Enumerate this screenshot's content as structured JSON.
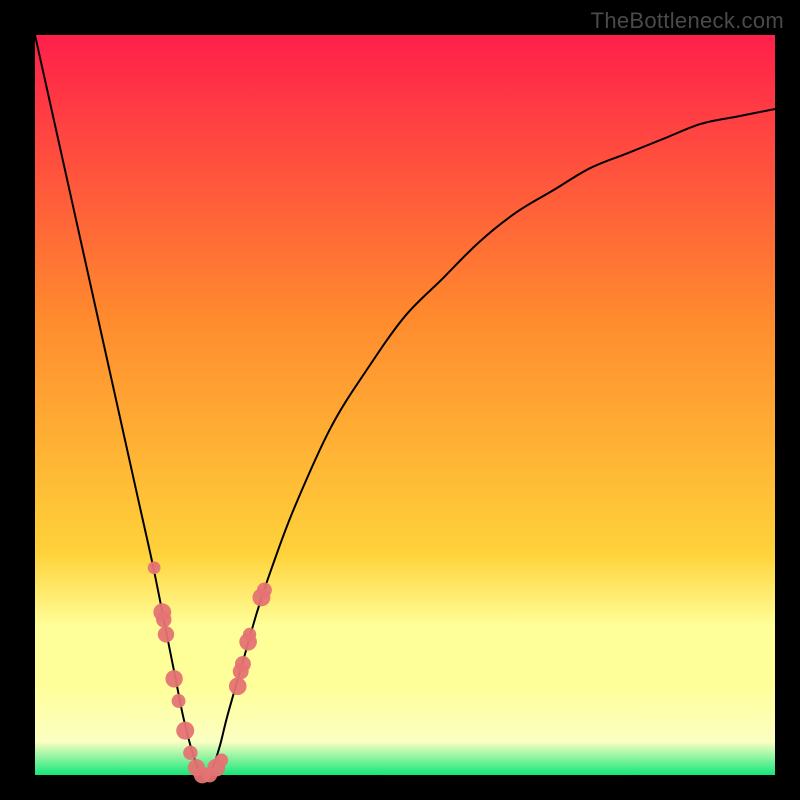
{
  "watermark": "TheBottleneck.com",
  "gradient_colors": {
    "top": "#ff1f4b",
    "mid_upper": "#ff8a2e",
    "mid": "#ffd23a",
    "band_pale": "#ffff9a",
    "band_light": "#fbffc2",
    "bottom": "#14e77a"
  },
  "curve": {
    "stroke": "#000000",
    "stroke_width": 2.0,
    "dot_color": "#e57373",
    "dot_stroke": "#c44f4f"
  },
  "chart_data": {
    "type": "line",
    "title": "",
    "xlabel": "",
    "ylabel": "",
    "xlim": [
      0,
      100
    ],
    "ylim": [
      0,
      100
    ],
    "x": [
      0,
      2,
      4,
      6,
      8,
      10,
      12,
      14,
      16,
      18,
      19,
      20,
      21,
      22,
      23,
      24,
      25,
      26,
      28,
      30,
      32,
      35,
      40,
      45,
      50,
      55,
      60,
      65,
      70,
      75,
      80,
      85,
      90,
      95,
      100
    ],
    "y": [
      100,
      91,
      82,
      73,
      64,
      55,
      46,
      37,
      28,
      18,
      13,
      8,
      4,
      1,
      0,
      1,
      4,
      8,
      15,
      22,
      28,
      36,
      47,
      55,
      62,
      67,
      72,
      76,
      79,
      82,
      84,
      86,
      88,
      89,
      90
    ],
    "dots": [
      {
        "x": 16.1,
        "y": 28
      },
      {
        "x": 17.2,
        "y": 22
      },
      {
        "x": 17.4,
        "y": 21
      },
      {
        "x": 17.7,
        "y": 19
      },
      {
        "x": 18.8,
        "y": 13
      },
      {
        "x": 19.4,
        "y": 10
      },
      {
        "x": 20.3,
        "y": 6
      },
      {
        "x": 21.0,
        "y": 3
      },
      {
        "x": 21.8,
        "y": 1
      },
      {
        "x": 22.6,
        "y": 0
      },
      {
        "x": 23.6,
        "y": 0
      },
      {
        "x": 24.5,
        "y": 1
      },
      {
        "x": 25.2,
        "y": 2
      },
      {
        "x": 27.4,
        "y": 12
      },
      {
        "x": 27.8,
        "y": 14
      },
      {
        "x": 28.1,
        "y": 15
      },
      {
        "x": 28.8,
        "y": 18
      },
      {
        "x": 29.0,
        "y": 19
      },
      {
        "x": 30.6,
        "y": 24
      },
      {
        "x": 31.0,
        "y": 25
      }
    ]
  }
}
